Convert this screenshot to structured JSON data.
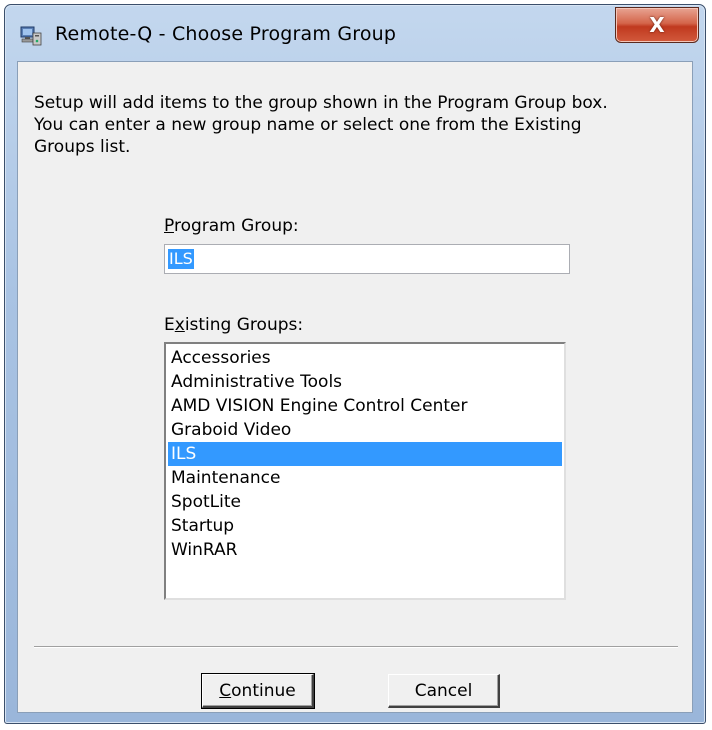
{
  "window": {
    "title": "Remote-Q - Choose Program Group",
    "close_glyph": "X",
    "icon": "setup-computer-icon"
  },
  "description": {
    "line1": "Setup will add items to the group shown in the Program Group box.",
    "line2": "You can enter a new group name or select one from the Existing",
    "line3": "Groups list."
  },
  "program_group": {
    "label_prefix": "",
    "label_accel": "P",
    "label_rest": "rogram Group:",
    "value": "ILS"
  },
  "existing_groups": {
    "label_prefix": "E",
    "label_accel": "x",
    "label_rest": "isting Groups:",
    "items": [
      "Accessories",
      "Administrative Tools",
      "AMD VISION Engine Control Center",
      "Graboid Video",
      "ILS",
      "Maintenance",
      "SpotLite",
      "Startup",
      "WinRAR"
    ],
    "selected_index": 4
  },
  "buttons": {
    "continue_accel": "C",
    "continue_rest": "ontinue",
    "cancel": "Cancel"
  },
  "colors": {
    "selection": "#3399ff",
    "dialog_bg": "#f0f0f0",
    "frame": "#a9c3e3",
    "close_button": "#c0391f"
  }
}
